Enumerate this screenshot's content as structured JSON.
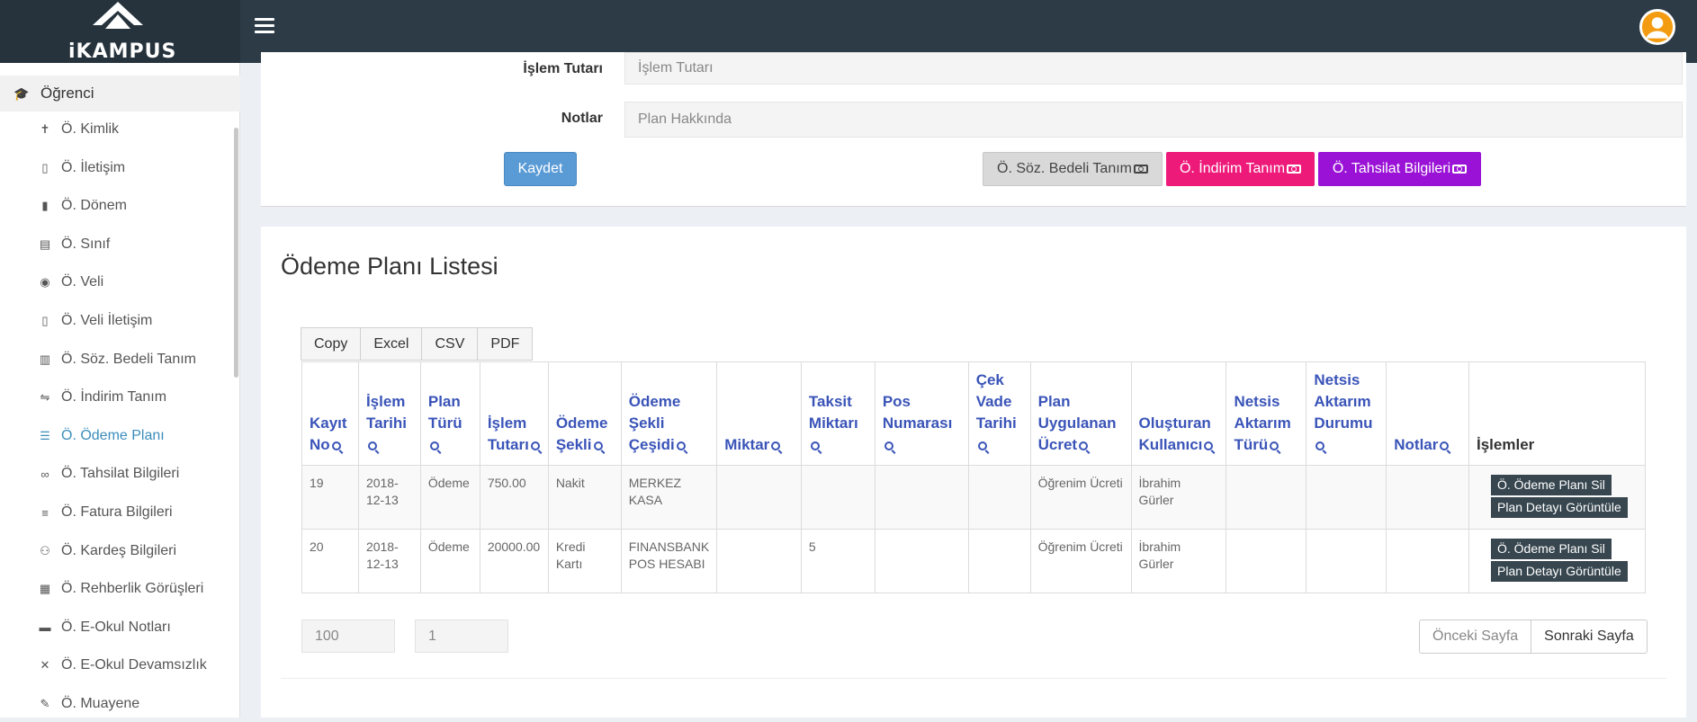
{
  "app": {
    "logo_text": "iKAMPUS"
  },
  "sidebar": {
    "header": "Öğrenci",
    "items": [
      {
        "label": "Ö. Kimlik",
        "icon": "person-icon"
      },
      {
        "label": "Ö. İletişim",
        "icon": "phone-icon"
      },
      {
        "label": "Ö. Dönem",
        "icon": "book-icon"
      },
      {
        "label": "Ö. Sınıf",
        "icon": "class-icon"
      },
      {
        "label": "Ö. Veli",
        "icon": "eye-icon"
      },
      {
        "label": "Ö. Veli İletişim",
        "icon": "phone-icon"
      },
      {
        "label": "Ö. Söz. Bedeli Tanım",
        "icon": "document-icon"
      },
      {
        "label": "Ö. İndirim Tanım",
        "icon": "discount-icon"
      },
      {
        "label": "Ö. Ödeme Planı",
        "icon": "list-icon"
      },
      {
        "label": "Ö. Tahsilat Bilgileri",
        "icon": "link-icon"
      },
      {
        "label": "Ö. Fatura Bilgileri",
        "icon": "lines-icon"
      },
      {
        "label": "Ö. Kardeş Bilgileri",
        "icon": "people-icon"
      },
      {
        "label": "Ö. Rehberlik Görüşleri",
        "icon": "chart-icon"
      },
      {
        "label": "Ö. E-Okul Notları",
        "icon": "card-icon"
      },
      {
        "label": "Ö. E-Okul Devamsızlık",
        "icon": "close-icon"
      },
      {
        "label": "Ö. Muayene",
        "icon": "pill-icon"
      }
    ],
    "active_index": 8
  },
  "form": {
    "amount_label": "İşlem Tutarı",
    "amount_placeholder": "İşlem Tutarı",
    "notes_label": "Notlar",
    "notes_placeholder": "Plan Hakkında",
    "save_label": "Kaydet",
    "btn_contract": "Ö. Söz. Bedeli Tanım",
    "btn_discount": "Ö. İndirim Tanım",
    "btn_collection": "Ö. Tahsilat Bilgileri"
  },
  "list": {
    "title": "Ödeme Planı Listesi",
    "exports": [
      "Copy",
      "Excel",
      "CSV",
      "PDF"
    ],
    "columns": [
      "Kayıt No",
      "İşlem Tarihi",
      "Plan Türü",
      "İşlem Tutarı",
      "Ödeme Şekli",
      "Ödeme Şekli Çeşidi",
      "Miktar",
      "Taksit Miktarı",
      "Pos Numarası",
      "Çek Vade Tarihi",
      "Plan Uygulanan Ücret",
      "Oluşturan Kullanıcı",
      "Netsis Aktarım Türü",
      "Netsis Aktarım Durumu",
      "Notlar",
      "İşlemler"
    ],
    "rows": [
      [
        "19",
        "2018-12-13",
        "Ödeme",
        "750.00",
        "Nakit",
        "MERKEZ KASA",
        "",
        "",
        "",
        "",
        "Öğrenim Ücreti",
        "İbrahim Gürler",
        "",
        "",
        ""
      ],
      [
        "20",
        "2018-12-13",
        "Ödeme",
        "20000.00",
        "Kredi Kartı",
        "FINANSBANK POS HESABI",
        "",
        "5",
        "",
        "",
        "Öğrenim Ücreti",
        "İbrahim Gürler",
        "",
        "",
        ""
      ]
    ],
    "action_delete": "Ö. Ödeme Planı Sil",
    "action_detail": "Plan Detayı Görüntüle"
  },
  "pagination": {
    "page_size": "100",
    "page_number": "1",
    "prev": "Önceki Sayfa",
    "next": "Sonraki Sayfa"
  },
  "colors": {
    "topbar": "#2c3b46",
    "accent_blue": "#3c8dbc",
    "header_link": "#3a54b8",
    "pink": "#ee1a7a",
    "purple": "#9a12d6"
  }
}
